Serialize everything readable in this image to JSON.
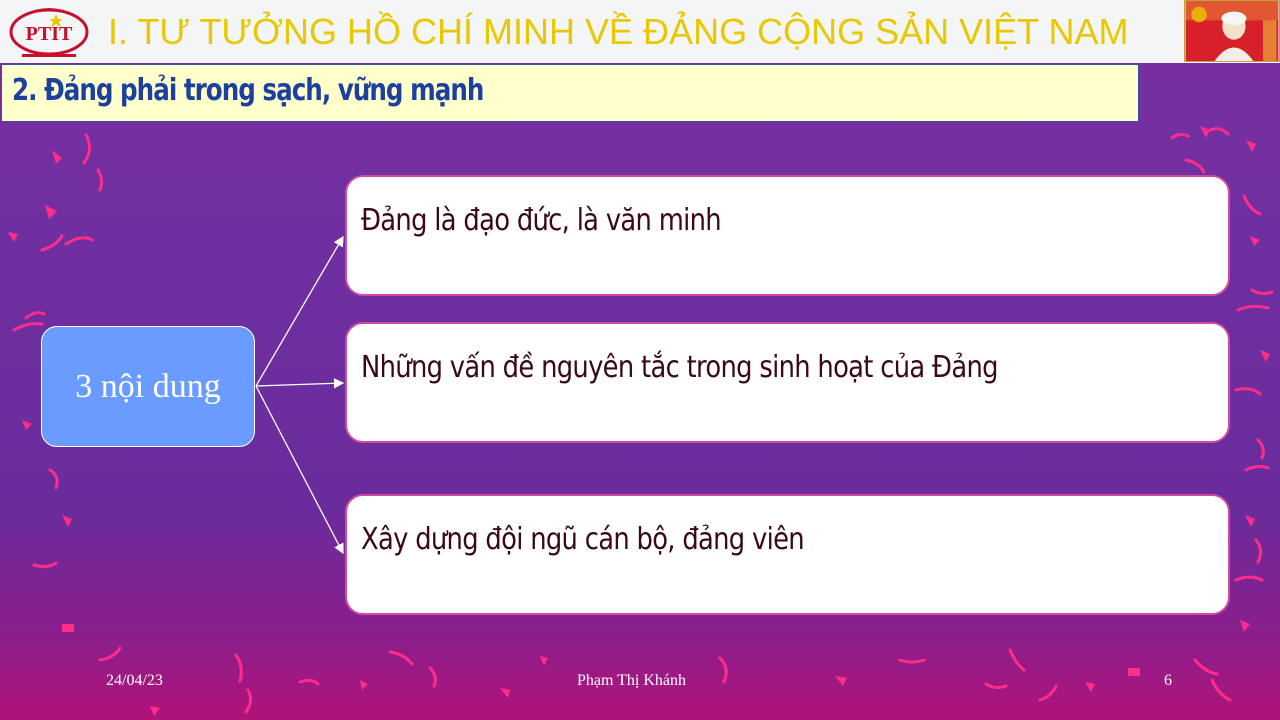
{
  "header": {
    "logo_text": "PTIT",
    "title": "I. TƯ TƯỞNG HỒ CHÍ MINH VỀ ĐẢNG CỘNG SẢN VIỆT NAM"
  },
  "subtitle": "2. Đảng phải trong sạch, vững mạnh",
  "diagram": {
    "root": "3 nội dung",
    "branches": [
      "Đảng là đạo đức, là văn minh",
      "Những vấn đề nguyên tắc trong sinh hoạt của Đảng",
      "Xây dựng đội ngũ cán bộ, đảng viên"
    ]
  },
  "footer": {
    "date": "24/04/23",
    "author": "Phạm Thị Khánh",
    "page": "6"
  },
  "colors": {
    "title": "#e8c800",
    "subtitle": "#1c3fa0",
    "root_fill": "#6a9bff",
    "branch_border": "#d24aa0",
    "confetti": "#ff2d8a"
  }
}
